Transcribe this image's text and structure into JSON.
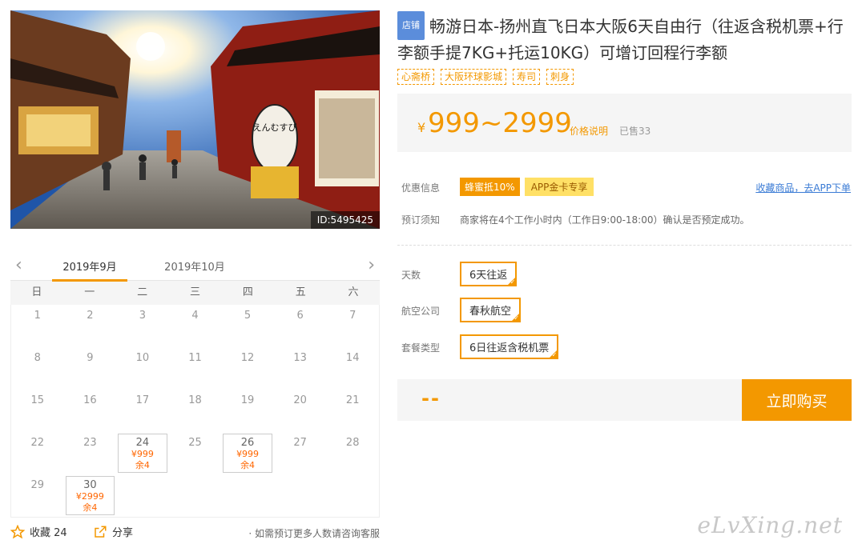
{
  "hero": {
    "id_label": "ID:5495425",
    "lantern_text": "えんむすび"
  },
  "calendar": {
    "tabs": [
      "2019年9月",
      "2019年10月"
    ],
    "weekdays": [
      "日",
      "一",
      "二",
      "三",
      "四",
      "五",
      "六"
    ],
    "days": [
      {
        "d": "1"
      },
      {
        "d": "2"
      },
      {
        "d": "3"
      },
      {
        "d": "4"
      },
      {
        "d": "5"
      },
      {
        "d": "6"
      },
      {
        "d": "7"
      },
      {
        "d": "8"
      },
      {
        "d": "9"
      },
      {
        "d": "10"
      },
      {
        "d": "11"
      },
      {
        "d": "12"
      },
      {
        "d": "13"
      },
      {
        "d": "14"
      },
      {
        "d": "15"
      },
      {
        "d": "16"
      },
      {
        "d": "17"
      },
      {
        "d": "18"
      },
      {
        "d": "19"
      },
      {
        "d": "20"
      },
      {
        "d": "21"
      },
      {
        "d": "22"
      },
      {
        "d": "23"
      },
      {
        "d": "24",
        "price": "¥999",
        "left": "余4"
      },
      {
        "d": "25"
      },
      {
        "d": "26",
        "price": "¥999",
        "left": "余4"
      },
      {
        "d": "27"
      },
      {
        "d": "28"
      },
      {
        "d": "29"
      },
      {
        "d": "30",
        "price": "¥2999",
        "left": "余4"
      }
    ]
  },
  "bottom": {
    "fav_label": "收藏 24",
    "share_label": "分享",
    "note": "· 如需预订更多人数请咨询客服"
  },
  "product": {
    "shop_badge": "店铺",
    "title": "畅游日本-扬州直飞日本大阪6天自由行（往返含税机票+行李额手提7KG+托运10KG）可增订回程行李额",
    "tags": [
      "心斋桥",
      "大阪环球影城",
      "寿司",
      "刺身"
    ]
  },
  "price": {
    "yen": "¥",
    "range": "999~2999",
    "explain": "价格说明",
    "sold": "已售33"
  },
  "promo": {
    "label": "优惠信息",
    "badges": [
      "蜂蜜抵10%",
      "APP金卡专享"
    ],
    "app_link": "收藏商品，去APP下单"
  },
  "notice": {
    "label": "预订须知",
    "text": "商家将在4个工作小时内（工作日9:00-18:00）确认是否预定成功。"
  },
  "options": [
    {
      "label": "天数",
      "value": "6天往返"
    },
    {
      "label": "航空公司",
      "value": "春秋航空"
    },
    {
      "label": "套餐类型",
      "value": "6日往返含税机票"
    }
  ],
  "buy": {
    "total": "--",
    "button": "立即购买"
  },
  "watermark": "eLvXing.net",
  "colors": {
    "accent": "#f39800",
    "badge": "#5b8ddb",
    "link": "#3a7bd5"
  }
}
